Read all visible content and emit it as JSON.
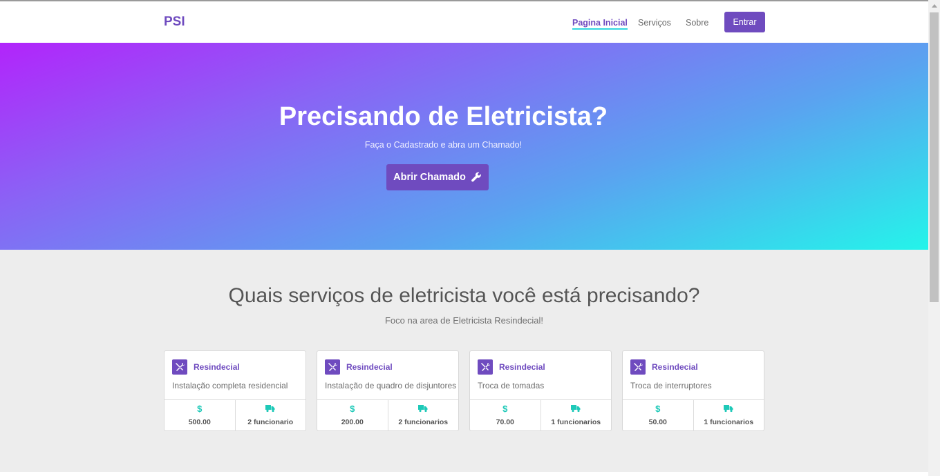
{
  "navbar": {
    "brand": "PSI",
    "links": [
      "Pagina Inicial",
      "Serviços",
      "Sobre"
    ],
    "login_label": "Entrar"
  },
  "hero": {
    "title": "Precisando de Eletricista?",
    "subtitle": "Faça o Cadastrado e abra um Chamado!",
    "button_label": "Abrir Chamado"
  },
  "services": {
    "title": "Quais serviços de eletricista você está precisando?",
    "subtitle": "Foco na area de Eletricista Resindecial!",
    "cards": [
      {
        "category": "Resindecial",
        "description": "Instalação completa residencial",
        "price_icon": "$",
        "price": "500.00",
        "staff": "2 funcionario"
      },
      {
        "category": "Resindecial",
        "description": "Instalação de quadro de disjuntores",
        "price_icon": "$",
        "price": "200.00",
        "staff": "2 funcionarios"
      },
      {
        "category": "Resindecial",
        "description": "Troca de tomadas",
        "price_icon": "$",
        "price": "70.00",
        "staff": "1 funcionarios"
      },
      {
        "category": "Resindecial",
        "description": "Troca de interruptores",
        "price_icon": "$",
        "price": "50.00",
        "staff": "1 funcionarios"
      }
    ]
  },
  "theme": {
    "accent": "#6f4bbf",
    "teal": "#1ec9b8",
    "gradient_start": "#b224fb",
    "gradient_end": "#24f4ea"
  },
  "icons": {
    "hero_button": "wrench-icon",
    "card_category": "tools-icon",
    "price": "dollar-icon",
    "staff": "truck-icon"
  }
}
